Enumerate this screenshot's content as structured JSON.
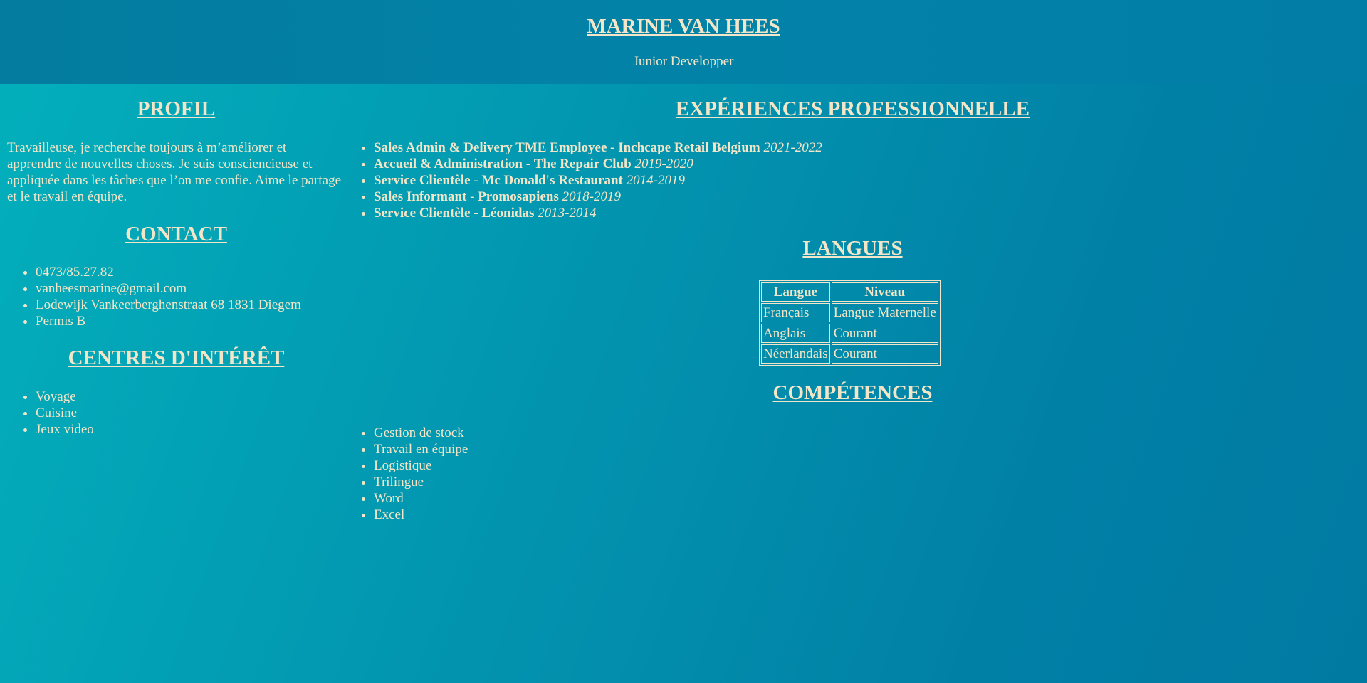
{
  "header": {
    "name": "MARINE VAN HEES",
    "subtitle": "Junior Developper"
  },
  "profil": {
    "title": "PROFIL",
    "text": "Travailleuse, je recherche toujours à m’améliorer et apprendre de nouvelles choses. Je suis consciencieuse et appliquée dans les tâches que l’on me confie. Aime le partage et le travail en équipe."
  },
  "contact": {
    "title": "CONTACT",
    "items": [
      "0473/85.27.82",
      "vanheesmarine@gmail.com",
      "Lodewijk Vankeerberghenstraat 68 1831 Diegem",
      "Permis B"
    ]
  },
  "interests": {
    "title": "CENTRES D'INTÉRÊT",
    "items": [
      "Voyage",
      "Cuisine",
      "Jeux video"
    ]
  },
  "experiences": {
    "title": "EXPÉRIENCES PROFESSIONNELLE",
    "items": [
      {
        "role": "Sales Admin & Delivery TME Employee",
        "sep": " - ",
        "company": "Inchcape Retail Belgium",
        "years": "2021-2022"
      },
      {
        "role": "Accueil & Administration",
        "sep": " - ",
        "company": "The Repair Club",
        "years": "2019-2020"
      },
      {
        "role": "Service Clientèle",
        "sep": " - ",
        "company": "Mc Donald's Restaurant",
        "years": "2014-2019"
      },
      {
        "role": "Sales Informant",
        "sep": " - ",
        "company": "Promosapiens",
        "years": "2018-2019"
      },
      {
        "role": "Service Clientèle",
        "sep": " - ",
        "company": "Léonidas",
        "years": "2013-2014"
      }
    ]
  },
  "langues": {
    "title": "LANGUES",
    "headers": [
      "Langue",
      "Niveau"
    ],
    "rows": [
      [
        "Français",
        "Langue Maternelle"
      ],
      [
        "Anglais",
        "Courant"
      ],
      [
        "Néerlandais",
        "Courant"
      ]
    ]
  },
  "competences": {
    "title": "COMPÉTENCES",
    "items": [
      "Gestion de stock",
      "Travail en équipe",
      "Logistique",
      "Trilingue",
      "Word",
      "Excel"
    ]
  },
  "colors": {
    "text": "#f3e6c8",
    "header_bg": "#037c9f",
    "body_gradient_start": "#03b0bc",
    "body_gradient_end": "#017aa2"
  }
}
